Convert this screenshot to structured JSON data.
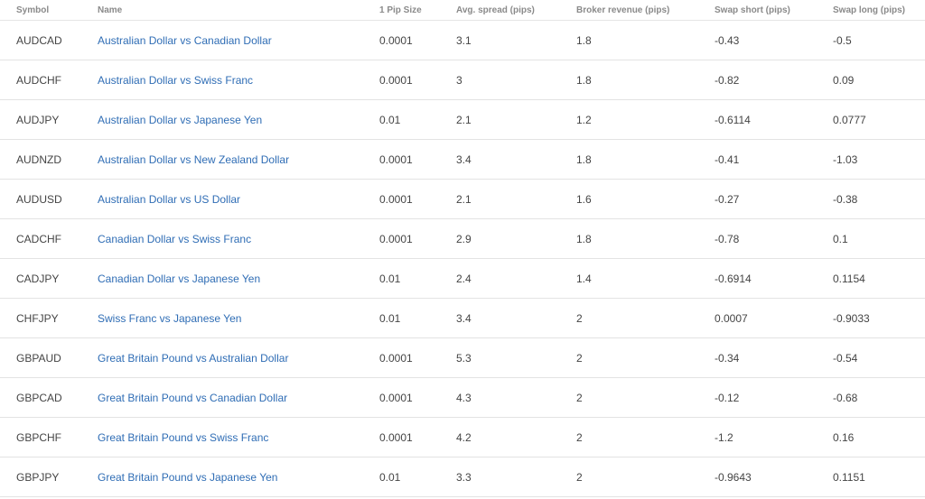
{
  "table": {
    "columns": [
      "Symbol",
      "Name",
      "1 Pip Size",
      "Avg. spread (pips)",
      "Broker revenue (pips)",
      "Swap short (pips)",
      "Swap long (pips)"
    ],
    "rows": [
      {
        "symbol": "AUDCAD",
        "name": "Australian Dollar vs Canadian Dollar",
        "pip_size": "0.0001",
        "avg_spread": "3.1",
        "broker_revenue": "1.8",
        "swap_short": "-0.43",
        "swap_long": "-0.5"
      },
      {
        "symbol": "AUDCHF",
        "name": "Australian Dollar vs Swiss Franc",
        "pip_size": "0.0001",
        "avg_spread": "3",
        "broker_revenue": "1.8",
        "swap_short": "-0.82",
        "swap_long": "0.09"
      },
      {
        "symbol": "AUDJPY",
        "name": "Australian Dollar vs Japanese Yen",
        "pip_size": "0.01",
        "avg_spread": "2.1",
        "broker_revenue": "1.2",
        "swap_short": "-0.6114",
        "swap_long": "0.0777"
      },
      {
        "symbol": "AUDNZD",
        "name": "Australian Dollar vs New Zealand Dollar",
        "pip_size": "0.0001",
        "avg_spread": "3.4",
        "broker_revenue": "1.8",
        "swap_short": "-0.41",
        "swap_long": "-1.03"
      },
      {
        "symbol": "AUDUSD",
        "name": "Australian Dollar vs US Dollar",
        "pip_size": "0.0001",
        "avg_spread": "2.1",
        "broker_revenue": "1.6",
        "swap_short": "-0.27",
        "swap_long": "-0.38"
      },
      {
        "symbol": "CADCHF",
        "name": "Canadian Dollar vs Swiss Franc",
        "pip_size": "0.0001",
        "avg_spread": "2.9",
        "broker_revenue": "1.8",
        "swap_short": "-0.78",
        "swap_long": "0.1"
      },
      {
        "symbol": "CADJPY",
        "name": "Canadian Dollar vs Japanese Yen",
        "pip_size": "0.01",
        "avg_spread": "2.4",
        "broker_revenue": "1.4",
        "swap_short": "-0.6914",
        "swap_long": "0.1154"
      },
      {
        "symbol": "CHFJPY",
        "name": "Swiss Franc vs Japanese Yen",
        "pip_size": "0.01",
        "avg_spread": "3.4",
        "broker_revenue": "2",
        "swap_short": "0.0007",
        "swap_long": "-0.9033"
      },
      {
        "symbol": "GBPAUD",
        "name": "Great Britain Pound vs Australian Dollar",
        "pip_size": "0.0001",
        "avg_spread": "5.3",
        "broker_revenue": "2",
        "swap_short": "-0.34",
        "swap_long": "-0.54"
      },
      {
        "symbol": "GBPCAD",
        "name": "Great Britain Pound vs Canadian Dollar",
        "pip_size": "0.0001",
        "avg_spread": "4.3",
        "broker_revenue": "2",
        "swap_short": "-0.12",
        "swap_long": "-0.68"
      },
      {
        "symbol": "GBPCHF",
        "name": "Great Britain Pound vs Swiss Franc",
        "pip_size": "0.0001",
        "avg_spread": "4.2",
        "broker_revenue": "2",
        "swap_short": "-1.2",
        "swap_long": "0.16"
      },
      {
        "symbol": "GBPJPY",
        "name": "Great Britain Pound vs Japanese Yen",
        "pip_size": "0.01",
        "avg_spread": "3.3",
        "broker_revenue": "2",
        "swap_short": "-0.9643",
        "swap_long": "0.1151"
      }
    ]
  }
}
